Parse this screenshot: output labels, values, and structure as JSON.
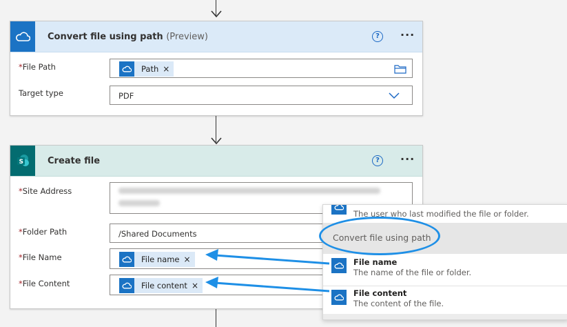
{
  "card1": {
    "title": "Convert file using path",
    "title_suffix": "(Preview)",
    "help": "?",
    "more": "···",
    "file_path_label": "File Path",
    "file_path_token": "Path",
    "target_type_label": "Target type",
    "target_type_value": "PDF"
  },
  "card2": {
    "title": "Create file",
    "help": "?",
    "more": "···",
    "site_address_label": "Site Address",
    "folder_path_label": "Folder Path",
    "folder_path_value": "/Shared Documents",
    "file_name_label": "File Name",
    "file_name_token": "File name",
    "file_content_label": "File Content",
    "file_content_token": "File content"
  },
  "required_marker": "*",
  "token_remove": "×",
  "dropdown": {
    "top_partial_desc": "The user who last modified the file or folder.",
    "section_title": "Convert file using path",
    "items": [
      {
        "name": "File name",
        "desc": "The name of the file or folder."
      },
      {
        "name": "File content",
        "desc": "The content of the file."
      }
    ]
  },
  "colors": {
    "onedrive_blue": "#1b73c4",
    "sharepoint_teal": "#036c70",
    "annotation_blue": "#1e8fe6",
    "required_red": "#a4262c"
  },
  "icons": [
    "onedrive-cloud-icon",
    "sharepoint-icon",
    "folder-icon",
    "chevron-down-icon",
    "help-icon",
    "more-icon"
  ]
}
